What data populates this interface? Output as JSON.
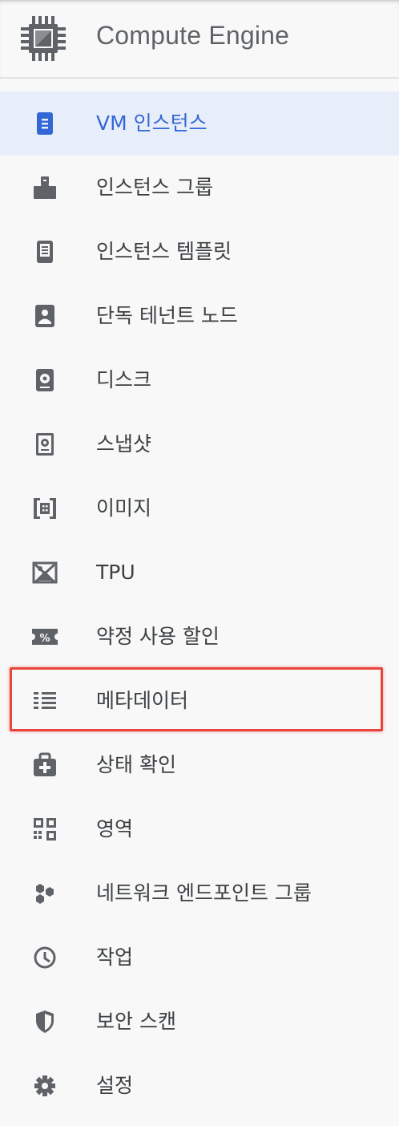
{
  "header": {
    "title": "Compute Engine",
    "logo_icon": "compute-engine-chip-icon"
  },
  "colors": {
    "active_bg": "#e8eef9",
    "active_text": "#3367d6",
    "highlight_border": "#e8453c",
    "icon_gray": "#5f6368"
  },
  "nav": {
    "items": [
      {
        "label": "VM 인스턴스",
        "icon": "vm-instance-icon",
        "active": true
      },
      {
        "label": "인스턴스 그룹",
        "icon": "instance-group-icon"
      },
      {
        "label": "인스턴스 템플릿",
        "icon": "instance-template-icon"
      },
      {
        "label": "단독 테넌트 노드",
        "icon": "sole-tenant-node-icon"
      },
      {
        "label": "디스크",
        "icon": "disk-icon"
      },
      {
        "label": "스냅샷",
        "icon": "snapshot-icon"
      },
      {
        "label": "이미지",
        "icon": "image-icon"
      },
      {
        "label": "TPU",
        "icon": "tpu-icon"
      },
      {
        "label": "약정 사용 할인",
        "icon": "committed-use-discount-icon"
      },
      {
        "label": "메타데이터",
        "icon": "metadata-icon",
        "highlighted": true
      },
      {
        "label": "상태 확인",
        "icon": "health-check-icon"
      },
      {
        "label": "영역",
        "icon": "zones-icon"
      },
      {
        "label": "네트워크 엔드포인트 그룹",
        "icon": "network-endpoint-group-icon"
      },
      {
        "label": "작업",
        "icon": "operations-clock-icon"
      },
      {
        "label": "보안 스캔",
        "icon": "security-scan-shield-icon"
      },
      {
        "label": "설정",
        "icon": "settings-gear-icon"
      }
    ]
  }
}
